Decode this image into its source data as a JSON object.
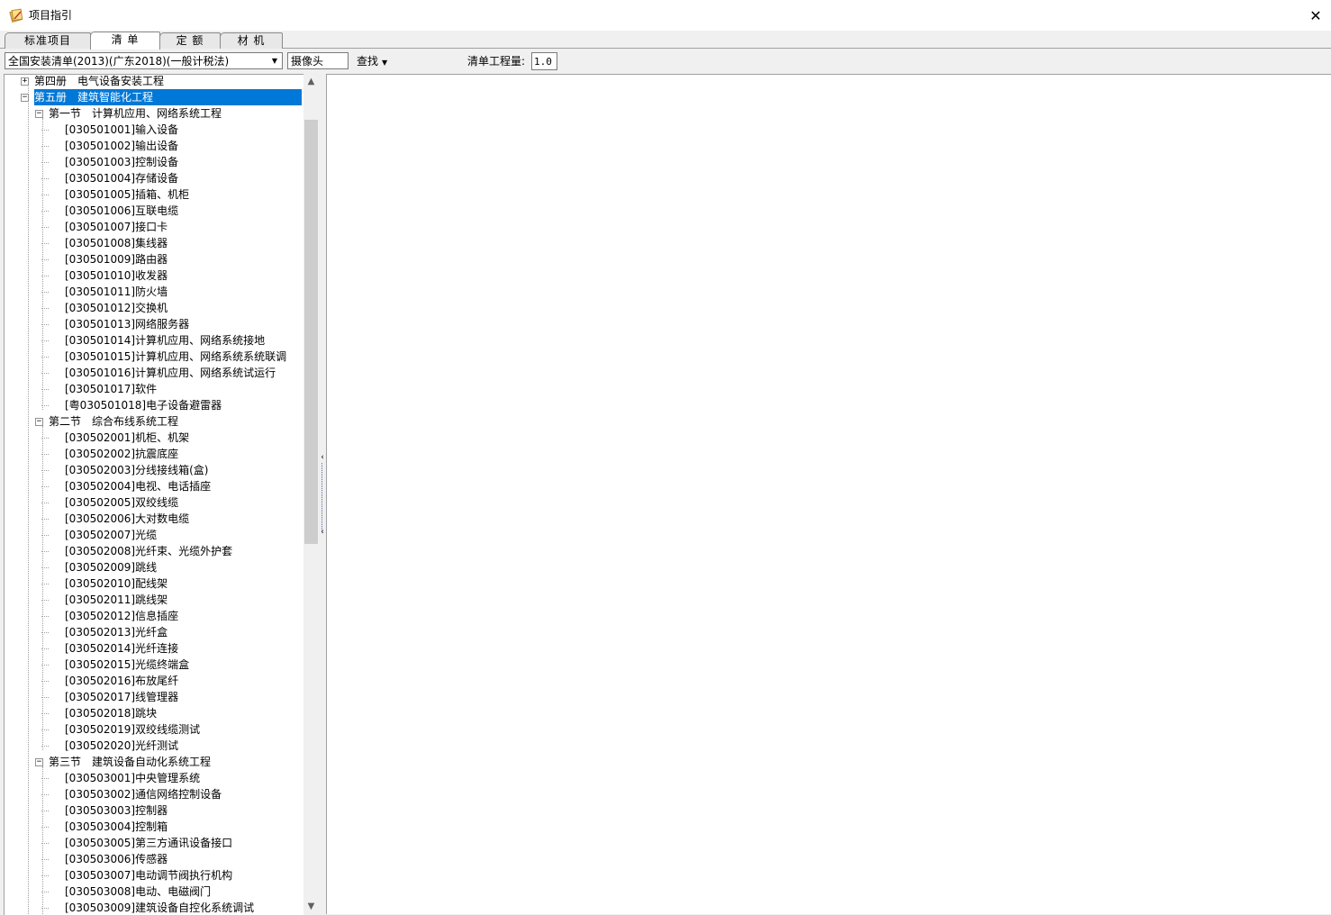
{
  "window": {
    "title": "项目指引",
    "close": "✕"
  },
  "tabs": [
    {
      "label": "标准项目"
    },
    {
      "label": "清 单"
    },
    {
      "label": "定 额"
    },
    {
      "label": "材 机"
    }
  ],
  "active_tab": 1,
  "toolbar": {
    "library_select": "全国安装清单(2013)(广东2018)(一般计税法)",
    "search_value": "摄像头",
    "find_label": "查找",
    "quantity_label": "清单工程量:",
    "quantity_value": "1.0"
  },
  "tree": [
    {
      "label": "第四册　电气设备安装工程",
      "level": 0,
      "expander": "+"
    },
    {
      "label": "第五册　建筑智能化工程",
      "level": 0,
      "expander": "−",
      "selected": true
    },
    {
      "label": "第一节　计算机应用、网络系统工程",
      "level": 1,
      "expander": "−"
    },
    {
      "label": "[030501001]输入设备",
      "level": 2
    },
    {
      "label": "[030501002]输出设备",
      "level": 2
    },
    {
      "label": "[030501003]控制设备",
      "level": 2
    },
    {
      "label": "[030501004]存储设备",
      "level": 2
    },
    {
      "label": "[030501005]插箱、机柜",
      "level": 2
    },
    {
      "label": "[030501006]互联电缆",
      "level": 2
    },
    {
      "label": "[030501007]接口卡",
      "level": 2
    },
    {
      "label": "[030501008]集线器",
      "level": 2
    },
    {
      "label": "[030501009]路由器",
      "level": 2
    },
    {
      "label": "[030501010]收发器",
      "level": 2
    },
    {
      "label": "[030501011]防火墙",
      "level": 2
    },
    {
      "label": "[030501012]交换机",
      "level": 2
    },
    {
      "label": "[030501013]网络服务器",
      "level": 2
    },
    {
      "label": "[030501014]计算机应用、网络系统接地",
      "level": 2
    },
    {
      "label": "[030501015]计算机应用、网络系统系统联调",
      "level": 2
    },
    {
      "label": "[030501016]计算机应用、网络系统试运行",
      "level": 2
    },
    {
      "label": "[030501017]软件",
      "level": 2
    },
    {
      "label": "[粤030501018]电子设备避雷器",
      "level": 2
    },
    {
      "label": "第二节　综合布线系统工程",
      "level": 1,
      "expander": "−"
    },
    {
      "label": "[030502001]机柜、机架",
      "level": 2
    },
    {
      "label": "[030502002]抗震底座",
      "level": 2
    },
    {
      "label": "[030502003]分线接线箱(盒)",
      "level": 2
    },
    {
      "label": "[030502004]电视、电话插座",
      "level": 2
    },
    {
      "label": "[030502005]双绞线缆",
      "level": 2
    },
    {
      "label": "[030502006]大对数电缆",
      "level": 2
    },
    {
      "label": "[030502007]光缆",
      "level": 2
    },
    {
      "label": "[030502008]光纤束、光缆外护套",
      "level": 2
    },
    {
      "label": "[030502009]跳线",
      "level": 2
    },
    {
      "label": "[030502010]配线架",
      "level": 2
    },
    {
      "label": "[030502011]跳线架",
      "level": 2
    },
    {
      "label": "[030502012]信息插座",
      "level": 2
    },
    {
      "label": "[030502013]光纤盒",
      "level": 2
    },
    {
      "label": "[030502014]光纤连接",
      "level": 2
    },
    {
      "label": "[030502015]光缆终端盒",
      "level": 2
    },
    {
      "label": "[030502016]布放尾纤",
      "level": 2
    },
    {
      "label": "[030502017]线管理器",
      "level": 2
    },
    {
      "label": "[030502018]跳块",
      "level": 2
    },
    {
      "label": "[030502019]双绞线缆测试",
      "level": 2
    },
    {
      "label": "[030502020]光纤测试",
      "level": 2
    },
    {
      "label": "第三节　建筑设备自动化系统工程",
      "level": 1,
      "expander": "−"
    },
    {
      "label": "[030503001]中央管理系统",
      "level": 2
    },
    {
      "label": "[030503002]通信网络控制设备",
      "level": 2
    },
    {
      "label": "[030503003]控制器",
      "level": 2
    },
    {
      "label": "[030503004]控制箱",
      "level": 2
    },
    {
      "label": "[030503005]第三方通讯设备接口",
      "level": 2
    },
    {
      "label": "[030503006]传感器",
      "level": 2
    },
    {
      "label": "[030503007]电动调节阀执行机构",
      "level": 2
    },
    {
      "label": "[030503008]电动、电磁阀门",
      "level": 2
    },
    {
      "label": "[030503009]建筑设备自控化系统调试",
      "level": 2
    }
  ],
  "colors": {
    "selection": "#0078d7",
    "window_bg": "#f0f0f0"
  },
  "icons": {
    "app": "folder-pencil-icon",
    "close": "close-icon",
    "dropdown": "chevron-down-icon"
  }
}
